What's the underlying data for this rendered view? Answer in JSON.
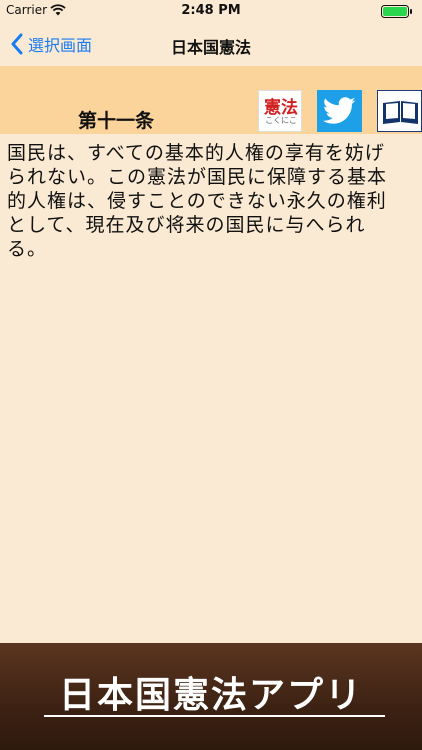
{
  "status_bar": {
    "carrier": "Carrier",
    "time": "2:48 PM",
    "icons": [
      "wifi-icon",
      "battery-icon"
    ]
  },
  "nav": {
    "back_label": "選択画面",
    "title": "日本国憲法"
  },
  "article": {
    "title": "第十一条",
    "logo_text": "憲法",
    "logo_subtext": "こくにこ",
    "body_lines": [
      "国民は、すべての基本的人権の享有を妨げ",
      "られない。この憲法が国民に保障する基本",
      "的人権は、侵すことのできない永久の権利",
      "として、現在及び将来の国民に与へられ",
      "る。"
    ],
    "action_icons": [
      "kenpo-logo",
      "twitter-icon",
      "book-icon"
    ]
  },
  "banner": {
    "text": "日本国憲法アプリ"
  },
  "colors": {
    "background": "#fbead3",
    "header_band": "#fbd49b",
    "link_blue": "#1a7cf5",
    "twitter_blue": "#1ea0e8",
    "banner_brown": "#3d2213",
    "logo_red": "#d21f1f"
  }
}
